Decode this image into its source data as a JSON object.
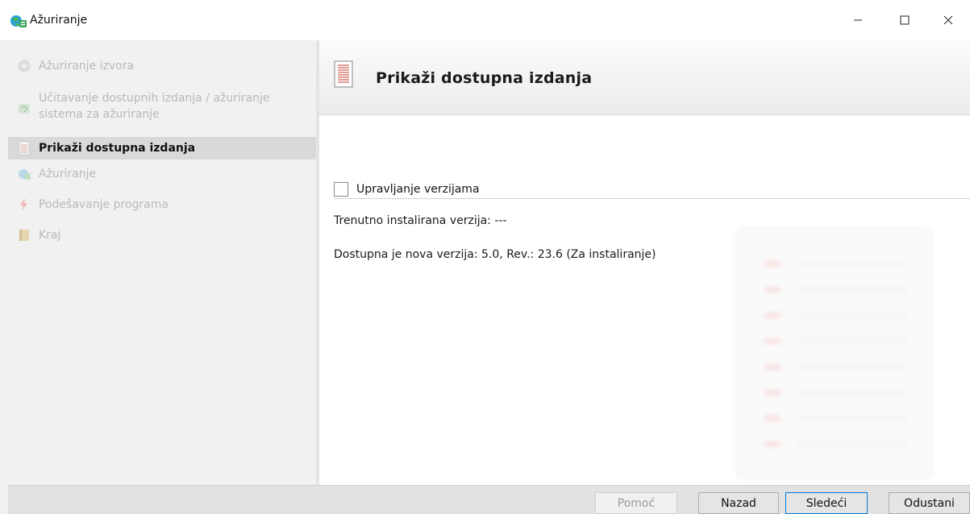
{
  "window": {
    "title": "Ažuriranje",
    "controls": {
      "minimize": "minimize",
      "maximize": "maximize",
      "close": "close"
    }
  },
  "sidebar": {
    "items": [
      {
        "label": "Ažuriranje izvora",
        "icon": "disc-icon",
        "state": "disabled"
      },
      {
        "label": "Učitavanje dostupnih izdanja / ažuriranje sistema za ažuriranje",
        "icon": "refresh-icon",
        "state": "disabled"
      },
      {
        "label": "Prikaži dostupna izdanja",
        "icon": "list-icon",
        "state": "active"
      },
      {
        "label": "Ažuriranje",
        "icon": "update-icon",
        "state": "disabled"
      },
      {
        "label": "Podešavanje programa",
        "icon": "bolt-icon",
        "state": "disabled"
      },
      {
        "label": "Kraj",
        "icon": "book-icon",
        "state": "disabled"
      }
    ]
  },
  "content": {
    "title": "Prikaži dostupna izdanja",
    "version_control_label": "Upravljanje verzijama",
    "version_control_checked": false,
    "installed_version": "Trenutno instalirana verzija: ---",
    "new_version": "Dostupna je nova verzija: 5.0, Rev.: 23.6 (Za instaliranje)"
  },
  "buttons": {
    "help": "Pomoć",
    "back": "Nazad",
    "next": "Sledeći",
    "cancel": "Odustani"
  },
  "colors": {
    "accent": "#0078d7",
    "active_item_bg": "#d9d9d9",
    "sidebar_bg": "#f1f1f1",
    "disabled_text": "#b9b9b9"
  }
}
